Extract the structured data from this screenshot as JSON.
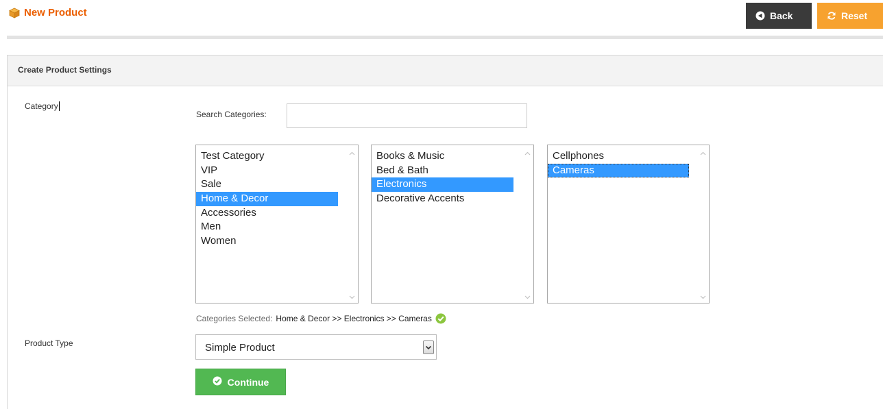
{
  "header": {
    "title": "New Product",
    "title_icon": "box-icon",
    "back_label": "Back",
    "reset_label": "Reset",
    "colors": {
      "title": "#eb5e00",
      "back_bg": "#3a3a3a",
      "reset_bg": "#f7a22f"
    }
  },
  "panel": {
    "title": "Create Product Settings"
  },
  "form": {
    "category_label": "Category",
    "search_label": "Search Categories:",
    "search_value": "",
    "lists": [
      {
        "items": [
          "Test Category",
          "VIP",
          "Sale",
          "Home & Decor",
          "Accessories",
          "Men",
          "Women"
        ],
        "selected": "Home & Decor"
      },
      {
        "items": [
          "Books & Music",
          "Bed & Bath",
          "Electronics",
          "Decorative Accents"
        ],
        "selected": "Electronics"
      },
      {
        "items": [
          "Cellphones",
          "Cameras"
        ],
        "selected": "Cameras"
      }
    ],
    "categories_selected_label": "Categories Selected:",
    "categories_selected_value": "Home & Decor >> Electronics >> Cameras",
    "product_type_label": "Product Type",
    "product_type_value": "Simple Product",
    "continue_label": "Continue",
    "colors": {
      "selection": "#3399ff",
      "continue_bg": "#52b852",
      "check": "#8cc63f"
    }
  }
}
